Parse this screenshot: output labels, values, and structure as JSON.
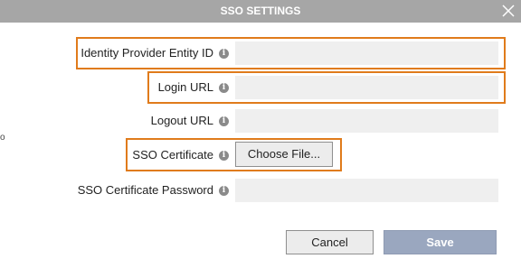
{
  "dialog": {
    "title": "SSO SETTINGS"
  },
  "fields": {
    "entity_id": {
      "label": "Identity Provider Entity ID",
      "value": "",
      "placeholder": ""
    },
    "login_url": {
      "label": "Login URL",
      "value": "",
      "placeholder": ""
    },
    "logout_url": {
      "label": "Logout URL",
      "value": "",
      "placeholder": ""
    },
    "certificate": {
      "label": "SSO Certificate",
      "button_label": "Choose File..."
    },
    "cert_password": {
      "label": "SSO Certificate Password",
      "value": "",
      "placeholder": ""
    }
  },
  "icons": {
    "info": "info-icon",
    "close": "close-icon"
  },
  "info_glyph": "i",
  "buttons": {
    "cancel": "Cancel",
    "save": "Save"
  },
  "edge_mark": "o",
  "colors": {
    "titlebar": "#a6a6a6",
    "highlight": "#e07b1b",
    "save_button": "#9aa7bf",
    "input_bg": "#efefef"
  }
}
